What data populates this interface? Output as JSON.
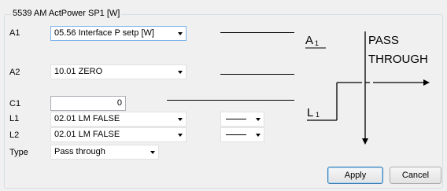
{
  "group_title": "5539 AM ActPower SP1 [W]",
  "rows": {
    "a1": {
      "label": "A1",
      "value": "05.56 Interface P setp [W]"
    },
    "a2": {
      "label": "A2",
      "value": "10.01 ZERO"
    },
    "c1": {
      "label": "C1",
      "value": "0"
    },
    "l1": {
      "label": "L1",
      "value": "02.01 LM FALSE"
    },
    "l2": {
      "label": "L2",
      "value": "02.01 LM FALSE"
    },
    "type": {
      "label": "Type",
      "value": "Pass through"
    }
  },
  "diagram": {
    "a_label": "A",
    "a_sub": "1",
    "l_label": "L",
    "l_sub": "1",
    "text_line1": "PASS",
    "text_line2": "THROUGH"
  },
  "buttons": {
    "apply": "Apply",
    "cancel": "Cancel"
  }
}
